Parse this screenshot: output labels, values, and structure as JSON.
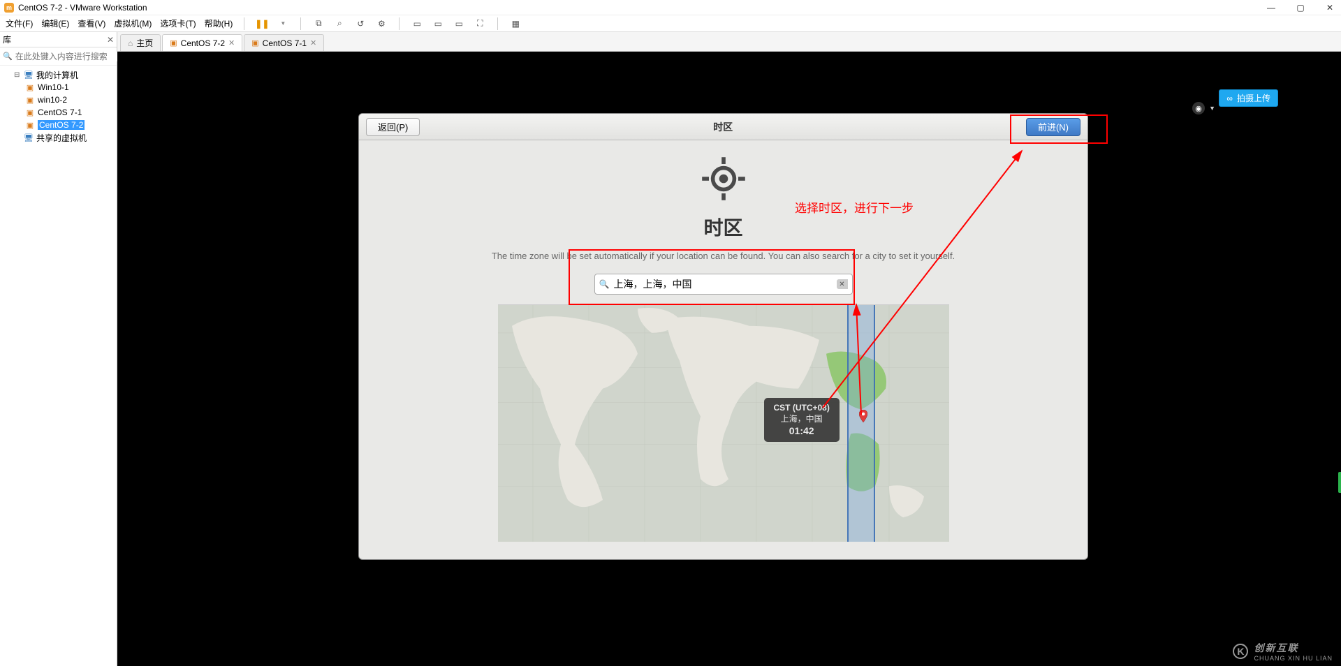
{
  "titlebar": {
    "title": "CentOS 7-2 - VMware Workstation"
  },
  "menubar": {
    "file": "文件(F)",
    "edit": "编辑(E)",
    "view": "查看(V)",
    "vm": "虚拟机(M)",
    "tabs": "选项卡(T)",
    "help": "帮助(H)"
  },
  "sidebar": {
    "title": "库",
    "search_placeholder": "在此处键入内容进行搜索",
    "nodes": {
      "my_computer": "我的计算机",
      "win10_1": "Win10-1",
      "win10_2": "win10-2",
      "centos71": "CentOS 7-1",
      "centos72": "CentOS 7-2",
      "shared": "共享的虚拟机"
    }
  },
  "tabs": {
    "home": "主页",
    "centos72": "CentOS 7-2",
    "centos71": "CentOS 7-1"
  },
  "upload": {
    "label": "拍摄上传"
  },
  "installer": {
    "back": "返回(P)",
    "forward": "前进(N)",
    "title": "时区",
    "section": "时区",
    "hint": "The time zone will be set automatically if your location can be found. You can also search for a city to set it yourself.",
    "search_value": "上海，上海，中国",
    "tooltip_line1": "CST (UTC+08)",
    "tooltip_line2": "上海，中国",
    "tooltip_line3": "01:42"
  },
  "annotation": {
    "text": "选择时区，进行下一步"
  },
  "watermark": {
    "brand": "创新互联",
    "sub": "CHUANG XIN HU LIAN"
  }
}
